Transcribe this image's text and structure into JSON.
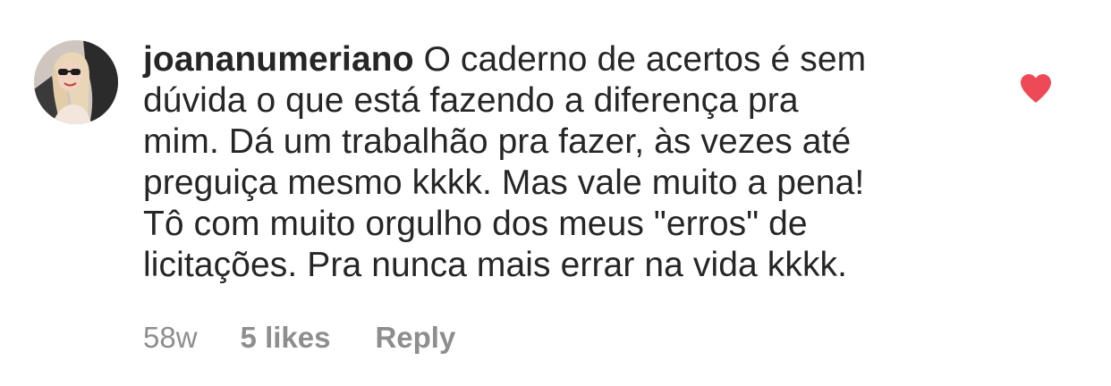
{
  "comment": {
    "username": "joananumeriano",
    "text_lines": [
      "O caderno de acertos é sem",
      "dúvida o que está fazendo a diferença pra",
      "mim. Dá um trabalhão pra fazer, às vezes até",
      "preguiça mesmo kkkk. Mas vale muito a pena!",
      "Tô com muito orgulho dos meus \"erros\" de",
      "licitações. Pra nunca mais errar na vida kkkk."
    ],
    "time": "58w",
    "likes": "5 likes",
    "reply_label": "Reply",
    "liked": true,
    "heart_color": "#ed4956",
    "avatar_icon": "profile-photo"
  }
}
